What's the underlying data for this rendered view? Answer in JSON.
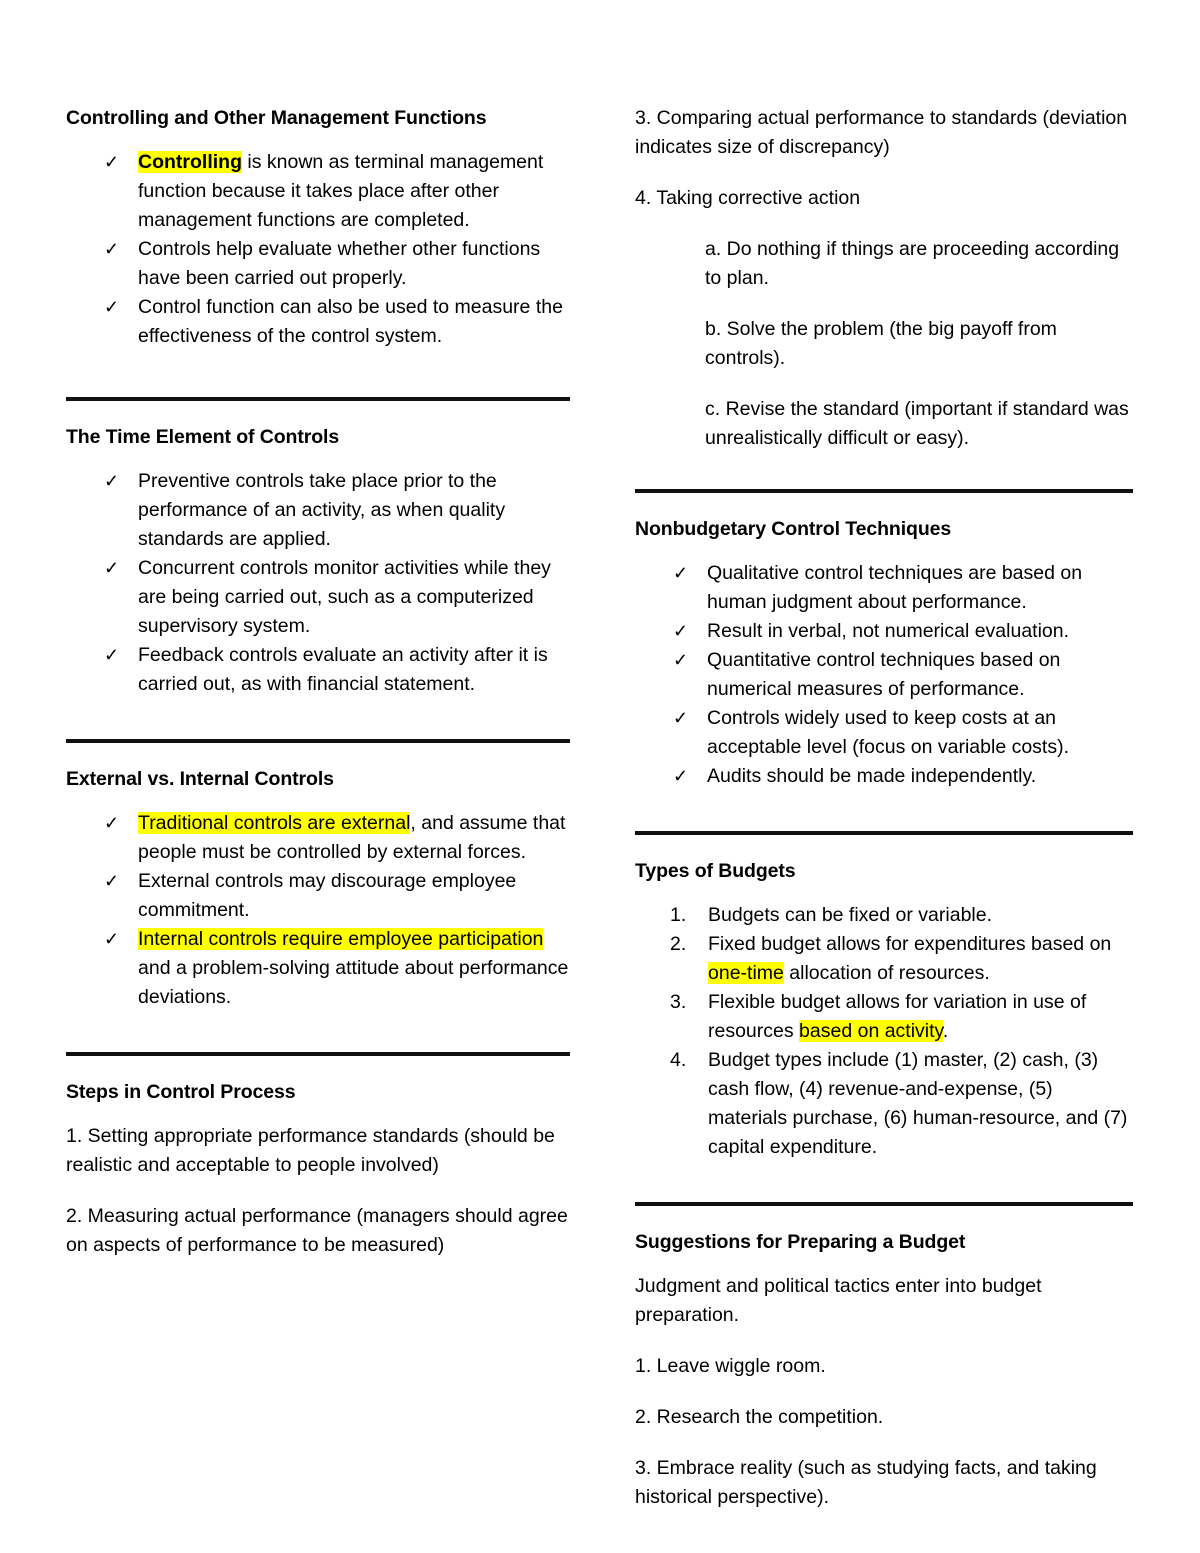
{
  "document": {
    "highlight_color": "#ffff00",
    "text_color": "#000000",
    "background_color": "#ffffff"
  },
  "left_column": {
    "section1": {
      "heading": "Controlling and Other Management Functions",
      "bullets": [
        {
          "highlight": "Controlling",
          "rest": " is known as terminal management function because it takes place after other management functions are completed."
        },
        {
          "highlight": "",
          "rest": "Controls help evaluate whether other functions have been carried out properly."
        },
        {
          "highlight": "",
          "rest": "Control function can also be used to measure the effectiveness of the control system."
        }
      ]
    },
    "section2": {
      "heading": "The Time Element of Controls",
      "bullets": [
        {
          "highlight": "",
          "rest": "Preventive controls take place prior to the performance of an activity, as when quality standards are applied."
        },
        {
          "highlight": "",
          "rest": "Concurrent controls monitor activities while they are being carried out, such as a computerized supervisory system."
        },
        {
          "highlight": "",
          "rest": "Feedback controls evaluate an activity after it is carried out, as with financial statement."
        }
      ]
    },
    "section3": {
      "heading": "External vs. Internal Controls",
      "bullets": [
        {
          "highlight": "Traditional controls are external",
          "rest": ", and assume that people must be controlled by external forces."
        },
        {
          "highlight": "",
          "rest": "External controls may discourage employee commitment."
        },
        {
          "highlight": "Internal controls require employee participation",
          "rest": " and a problem-solving attitude about performance deviations."
        }
      ]
    },
    "section4": {
      "heading": "Steps in Control Process",
      "paragraphs": [
        "1. Setting appropriate performance standards (should be realistic and acceptable to people involved)",
        "2. Measuring actual performance (managers should agree on aspects of performance to be measured)"
      ]
    }
  },
  "right_column": {
    "section1": {
      "paragraphs": [
        "3. Comparing actual performance to standards (deviation indicates size of discrepancy)",
        "4. Taking corrective action"
      ],
      "subitems": [
        "a. Do nothing if things are proceeding according to plan.",
        "b. Solve the problem (the big payoff from controls).",
        "c. Revise the standard (important if standard was unrealistically difficult or easy)."
      ]
    },
    "section2": {
      "heading": "Nonbudgetary Control Techniques",
      "bullets": [
        "Qualitative control techniques are based on human judgment about performance.",
        "Result in verbal, not numerical evaluation.",
        "Quantitative control techniques based on numerical measures of performance.",
        "Controls widely used to keep costs at an acceptable level (focus on variable costs).",
        "Audits should be made independently."
      ]
    },
    "section3": {
      "heading": "Types of Budgets",
      "items": [
        {
          "pre": "Budgets can be fixed or variable.",
          "highlight": "",
          "post": ""
        },
        {
          "pre": "Fixed budget allows for expenditures based on ",
          "highlight": "one-time",
          "post": " allocation of resources."
        },
        {
          "pre": "Flexible budget allows for variation in use of resources ",
          "highlight": "based on activity",
          "post": "."
        },
        {
          "pre": "Budget types include (1) master, (2) cash, (3) cash flow, (4) revenue-and-expense, (5) materials purchase, (6) human-resource, and (7) capital expenditure.",
          "highlight": "",
          "post": ""
        }
      ]
    },
    "section4": {
      "heading": "Suggestions for Preparing a Budget",
      "paragraphs": [
        "Judgment and political tactics enter into budget preparation.",
        "1. Leave wiggle room.",
        "2. Research the competition.",
        "3. Embrace reality (such as studying facts, and taking historical perspective)."
      ]
    }
  },
  "icons": {
    "checkmark": "✓"
  }
}
